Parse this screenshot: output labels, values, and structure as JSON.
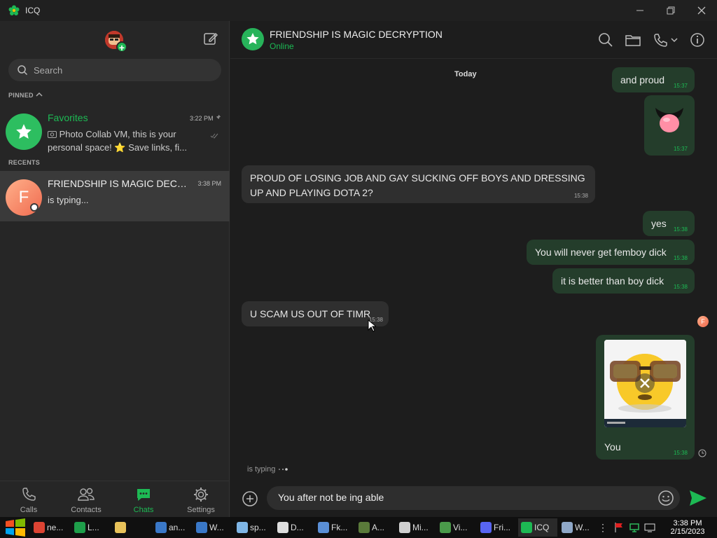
{
  "window": {
    "title": "ICQ"
  },
  "sidebar": {
    "search_placeholder": "Search",
    "pinned_label": "PINNED",
    "recents_label": "RECENTS",
    "favorites": {
      "name": "Favorites",
      "time": "3:22 PM",
      "preview": "Photo Collab VM, this is your personal space! ⭐ Save links, fi..."
    },
    "recent_chat": {
      "initial": "F",
      "name": "FRIENDSHIP IS MAGIC DECRY...",
      "time": "3:38 PM",
      "preview": "is typing..."
    },
    "nav": [
      {
        "label": "Calls"
      },
      {
        "label": "Contacts"
      },
      {
        "label": "Chats"
      },
      {
        "label": "Settings"
      }
    ]
  },
  "chat": {
    "title": "FRIENDSHIP IS MAGIC DECRYPTION",
    "status": "Online",
    "day": "Today",
    "messages": [
      {
        "text": "and proud",
        "time": "15:37"
      },
      {
        "text": "",
        "time": "15:37"
      },
      {
        "text": "PROUD OF LOSING JOB AND GAY SUCKING OFF BOYS AND DRESSING UP AND PLAYING DOTA 2?",
        "time": "15:38"
      },
      {
        "text": "yes",
        "time": "15:38"
      },
      {
        "text": "You will never get femboy dick",
        "time": "15:38"
      },
      {
        "text": "it is better than boy dick",
        "time": "15:38"
      },
      {
        "text": "U SCAM US OUT OF TIMR",
        "time": "15:38"
      },
      {
        "text": "You",
        "time": "15:38"
      }
    ],
    "read_avatar_initial": "F",
    "typing": "is typing",
    "composer_value": "You after not be ing able"
  },
  "taskbar": {
    "items": [
      {
        "label": "ne...",
        "icon": "chrome-icon",
        "color": "#dd4433"
      },
      {
        "label": "L...",
        "icon": "spreadsheet-icon",
        "color": "#1e9e4a"
      },
      {
        "label": "",
        "icon": "folder-icon",
        "color": "#e8c25a"
      },
      {
        "label": "an...",
        "icon": "paint-icon",
        "color": "#3a78c8"
      },
      {
        "label": "W...",
        "icon": "paint-icon",
        "color": "#3a78c8"
      },
      {
        "label": "sp...",
        "icon": "bubbles-icon",
        "color": "#7fb6e6"
      },
      {
        "label": "D...",
        "icon": "document-icon",
        "color": "#dddddd"
      },
      {
        "label": "Fk...",
        "icon": "image-viewer-icon",
        "color": "#5a8fd6"
      },
      {
        "label": "A...",
        "icon": "tree-icon",
        "color": "#5a7a3a"
      },
      {
        "label": "Mi...",
        "icon": "java-icon",
        "color": "#d0d0d0"
      },
      {
        "label": "Vi...",
        "icon": "virtualbox-icon",
        "color": "#4a9a4a"
      },
      {
        "label": "Fri...",
        "icon": "discord-icon",
        "color": "#5865f2"
      },
      {
        "label": "ICQ",
        "icon": "icq-icon",
        "color": "#1db954"
      },
      {
        "label": "W...",
        "icon": "monitor-icon",
        "color": "#8fa8c8"
      }
    ],
    "clock_time": "3:38 PM",
    "clock_date": "2/15/2023"
  }
}
